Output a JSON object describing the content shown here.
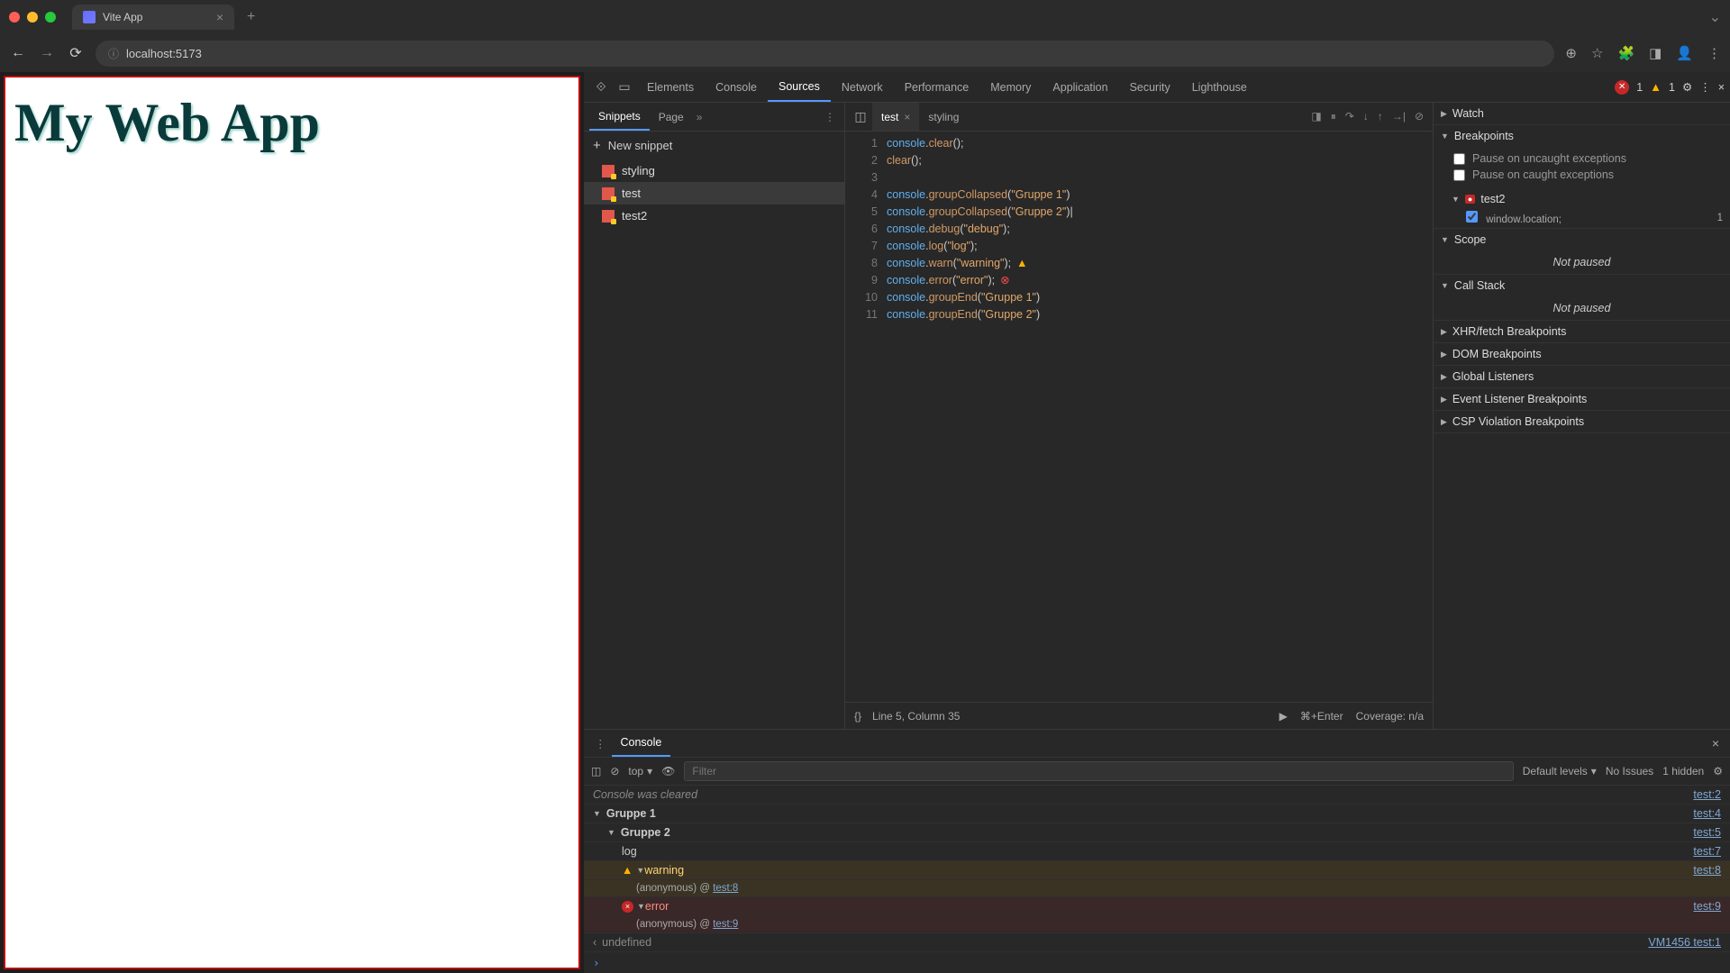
{
  "browser": {
    "tab_title": "Vite App",
    "url": "localhost:5173"
  },
  "page": {
    "heading": "My Web App"
  },
  "devtools": {
    "tabs": [
      "Elements",
      "Console",
      "Sources",
      "Network",
      "Performance",
      "Memory",
      "Application",
      "Security",
      "Lighthouse"
    ],
    "active_tab": "Sources",
    "error_count": "1",
    "warning_count": "1"
  },
  "sources": {
    "left_tabs": {
      "active": "Snippets",
      "other": "Page"
    },
    "new_snippet_label": "New snippet",
    "snippets": [
      "styling",
      "test",
      "test2"
    ],
    "selected_snippet": "test",
    "editor_tabs": {
      "active": "test",
      "other": "styling"
    },
    "code_lines": [
      "console.clear();",
      "clear();",
      "",
      "console.groupCollapsed(\"Gruppe 1\")",
      "console.groupCollapsed(\"Gruppe 2\")",
      "console.debug(\"debug\");",
      "console.log(\"log\");",
      "console.warn(\"warning\");",
      "console.error(\"error\");",
      "console.groupEnd(\"Gruppe 1\")",
      "console.groupEnd(\"Gruppe 2\")"
    ],
    "status": {
      "pretty": "{}",
      "position": "Line 5, Column 35",
      "run": "⌘+Enter",
      "coverage": "Coverage: n/a"
    }
  },
  "right_panel": {
    "watch": "Watch",
    "breakpoints": "Breakpoints",
    "pause_uncaught": "Pause on uncaught exceptions",
    "pause_caught": "Pause on caught exceptions",
    "bp_file": "test2",
    "bp_expr": "window.location;",
    "bp_line": "1",
    "scope": "Scope",
    "not_paused": "Not paused",
    "callstack": "Call Stack",
    "xhr": "XHR/fetch Breakpoints",
    "dom": "DOM Breakpoints",
    "global": "Global Listeners",
    "evt": "Event Listener Breakpoints",
    "csp": "CSP Violation Breakpoints"
  },
  "console": {
    "tab": "Console",
    "context": "top",
    "filter_placeholder": "Filter",
    "levels": "Default levels",
    "issues": "No Issues",
    "hidden": "1 hidden",
    "rows": {
      "cleared": "Console was cleared",
      "cleared_src": "test:2",
      "g1": "Gruppe 1",
      "g1_src": "test:4",
      "g2": "Gruppe 2",
      "g2_src": "test:5",
      "log": "log",
      "log_src": "test:7",
      "warn": "warning",
      "warn_src": "test:8",
      "warn_stack_a": "(anonymous)",
      "warn_stack_b": "test:8",
      "err": "error",
      "err_src": "test:9",
      "err_stack_a": "(anonymous)",
      "err_stack_b": "test:9",
      "undef": "undefined",
      "undef_src": "VM1456 test:1"
    }
  }
}
